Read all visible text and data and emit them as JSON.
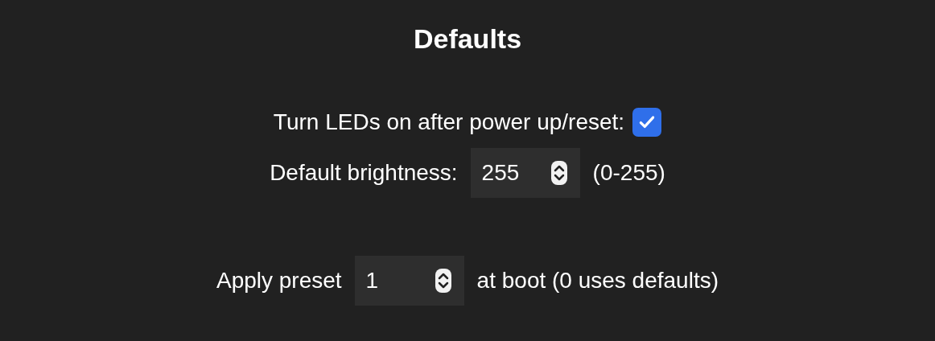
{
  "title": "Defaults",
  "leds_on": {
    "label": "Turn LEDs on after power up/reset:",
    "checked": true
  },
  "brightness": {
    "label": "Default brightness:",
    "value": "255",
    "hint": "(0-255)"
  },
  "boot_preset": {
    "label": "Apply preset",
    "value": "1",
    "hint": "at boot (0 uses defaults)"
  }
}
